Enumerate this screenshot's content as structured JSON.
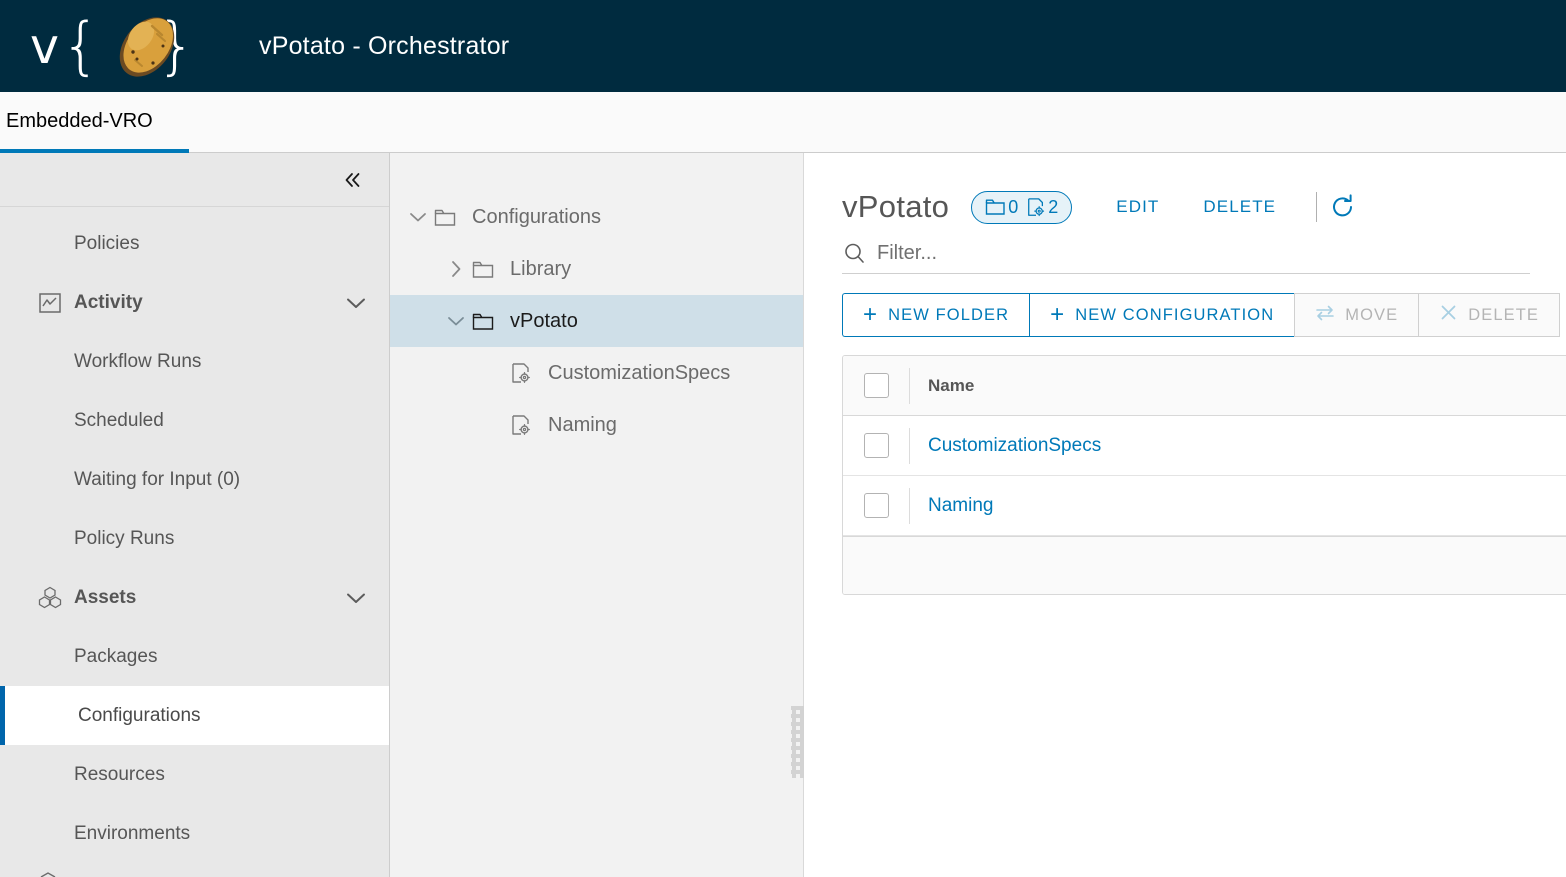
{
  "header": {
    "logo_v": "v",
    "brace_left": "{",
    "brace_right": "}",
    "logo_icon": "potato-icon",
    "title": "vPotato - Orchestrator",
    "bg_color": "#002b3f"
  },
  "tabs": [
    {
      "label": "Embedded-VRO",
      "active": true,
      "accent": "#0079b8"
    }
  ],
  "sidebar": {
    "collapse_icon": "double-chevron-left-icon",
    "items": [
      {
        "label": "Policies",
        "type": "child",
        "icon": ""
      },
      {
        "label": "Activity",
        "type": "group",
        "icon": "activity-chart-icon",
        "chevron": "chevron-down-icon"
      },
      {
        "label": "Workflow Runs",
        "type": "child",
        "icon": ""
      },
      {
        "label": "Scheduled",
        "type": "child",
        "icon": ""
      },
      {
        "label": "Waiting for Input (0)",
        "type": "child",
        "icon": ""
      },
      {
        "label": "Policy Runs",
        "type": "child",
        "icon": ""
      },
      {
        "label": "Assets",
        "type": "group",
        "icon": "cubes-icon",
        "chevron": "chevron-down-icon"
      },
      {
        "label": "Packages",
        "type": "child",
        "icon": ""
      },
      {
        "label": "Configurations",
        "type": "child",
        "icon": "",
        "selected": true
      },
      {
        "label": "Resources",
        "type": "child",
        "icon": ""
      },
      {
        "label": "Environments",
        "type": "child",
        "icon": ""
      }
    ],
    "selected_accent": "#0065ab"
  },
  "tree": {
    "nodes": [
      {
        "label": "Configurations",
        "level": 0,
        "icon": "folder-icon",
        "toggle": "chevron-down-icon",
        "expanded": true,
        "selected": false
      },
      {
        "label": "Library",
        "level": 1,
        "icon": "folder-icon",
        "toggle": "chevron-right-icon",
        "expanded": false,
        "selected": false
      },
      {
        "label": "vPotato",
        "level": 1,
        "icon": "folder-icon",
        "toggle": "chevron-down-icon",
        "expanded": true,
        "selected": true
      },
      {
        "label": "CustomizationSpecs",
        "level": 2,
        "icon": "config-file-icon",
        "toggle": "",
        "expanded": false,
        "selected": false
      },
      {
        "label": "Naming",
        "level": 2,
        "icon": "config-file-icon",
        "toggle": "",
        "expanded": false,
        "selected": false
      }
    ],
    "splitter_icon": "drag-handle-icon"
  },
  "content": {
    "title": "vPotato",
    "pill": {
      "folder_icon": "folder-icon",
      "folder_count": "0",
      "config_icon": "config-file-icon",
      "config_count": "2",
      "accent": "#0079b8"
    },
    "edit_label": "EDIT",
    "delete_label": "DELETE",
    "refresh_icon": "refresh-icon",
    "filter": {
      "icon": "search-icon",
      "placeholder": "Filter...",
      "value": ""
    },
    "toolbar": [
      {
        "label": "NEW FOLDER",
        "icon": "plus-icon",
        "disabled": false
      },
      {
        "label": "NEW CONFIGURATION",
        "icon": "plus-icon",
        "disabled": false
      },
      {
        "label": "MOVE",
        "icon": "move-arrows-icon",
        "disabled": true
      },
      {
        "label": "DELETE",
        "icon": "close-x-icon",
        "disabled": true
      }
    ],
    "table": {
      "columns": [
        "Name"
      ],
      "rows": [
        {
          "name": "CustomizationSpecs",
          "checked": false
        },
        {
          "name": "Naming",
          "checked": false
        }
      ]
    }
  }
}
